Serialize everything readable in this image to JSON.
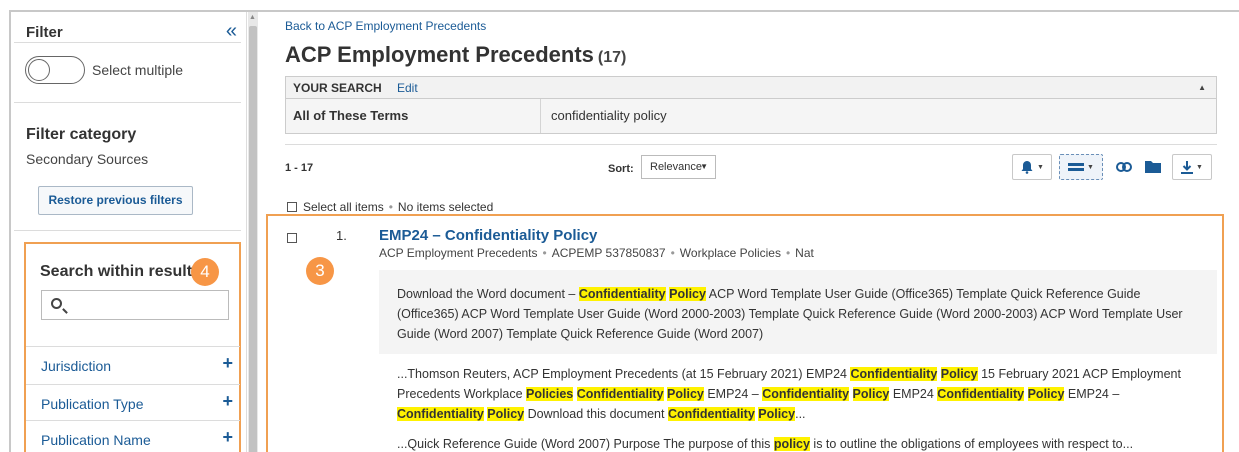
{
  "sidebar": {
    "title": "Filter",
    "collapse_icon": "«",
    "toggle_label": "Select multiple",
    "filter_category_title": "Filter category",
    "filter_category_value": "Secondary Sources",
    "restore_label": "Restore previous filters",
    "search_within_title": "Search within results",
    "badge_4": "4",
    "facets": [
      {
        "label": "Jurisdiction",
        "icon": "+"
      },
      {
        "label": "Publication Type",
        "icon": "+"
      },
      {
        "label": "Publication Name",
        "icon": "+"
      }
    ]
  },
  "main": {
    "back_link": "Back to ACP Employment Precedents",
    "title": "ACP Employment Precedents",
    "count": "(17)",
    "your_search": {
      "label": "YOUR SEARCH",
      "edit": "Edit",
      "terms_label": "All of These Terms",
      "terms_value": "confidentiality policy"
    },
    "range": "1 - 17",
    "sort_label": "Sort:",
    "sort_value": "Relevance",
    "select_all": "Select all items",
    "selected_status": "No items selected",
    "badge_3": "3"
  },
  "result": {
    "number": "1.",
    "title": "EMP24 – Confidentiality Policy",
    "meta": [
      "ACP Employment Precedents",
      "ACPEMP 537850837",
      "Workplace Policies",
      "Nat"
    ],
    "snippet_1": [
      {
        "t": "Download the Word document – "
      },
      {
        "t": "Confidentiality",
        "h": true
      },
      {
        "t": " "
      },
      {
        "t": "Policy",
        "h": true
      },
      {
        "t": " ACP Word Template User Guide (Office365) Template Quick Reference Guide (Office365) ACP Word Template User Guide (Word 2000-2003) Template Quick Reference Guide (Word 2000-2003) ACP Word Template User Guide (Word 2007) Template Quick Reference Guide (Word 2007)"
      }
    ],
    "snippet_2": [
      {
        "t": "...Thomson Reuters, ACP Employment Precedents (at 15 February 2021) EMP24 "
      },
      {
        "t": "Confidentiality",
        "h": true
      },
      {
        "t": " "
      },
      {
        "t": "Policy",
        "h": true
      },
      {
        "t": " 15 February 2021 ACP Employment Precedents Workplace "
      },
      {
        "t": "Policies",
        "h": true
      },
      {
        "t": " "
      },
      {
        "t": "Confidentiality",
        "h": true
      },
      {
        "t": " "
      },
      {
        "t": "Policy",
        "h": true
      },
      {
        "t": " EMP24 – "
      },
      {
        "t": "Confidentiality",
        "h": true
      },
      {
        "t": " "
      },
      {
        "t": "Policy",
        "h": true
      },
      {
        "t": " EMP24 "
      },
      {
        "t": "Confidentiality",
        "h": true
      },
      {
        "t": " "
      },
      {
        "t": "Policy",
        "h": true
      },
      {
        "t": " EMP24 – "
      },
      {
        "t": "Confidentiality",
        "h": true
      },
      {
        "t": " "
      },
      {
        "t": "Policy",
        "h": true
      },
      {
        "t": " Download this document "
      },
      {
        "t": "Confidentiality",
        "h": true
      },
      {
        "t": " "
      },
      {
        "t": "Policy",
        "h": true
      },
      {
        "t": "..."
      }
    ],
    "snippet_3": [
      {
        "t": "...Quick Reference Guide (Word 2007) Purpose The purpose of this "
      },
      {
        "t": "policy",
        "h": true
      },
      {
        "t": " is to outline the obligations of employees with respect to..."
      }
    ]
  },
  "toolbar_icons": [
    "bell-icon",
    "list-view-icon",
    "link-icon",
    "folder-icon",
    "download-icon"
  ],
  "colors": {
    "link": "#1b5b96",
    "highlight": "#fff200",
    "annotation": "#f79646"
  }
}
